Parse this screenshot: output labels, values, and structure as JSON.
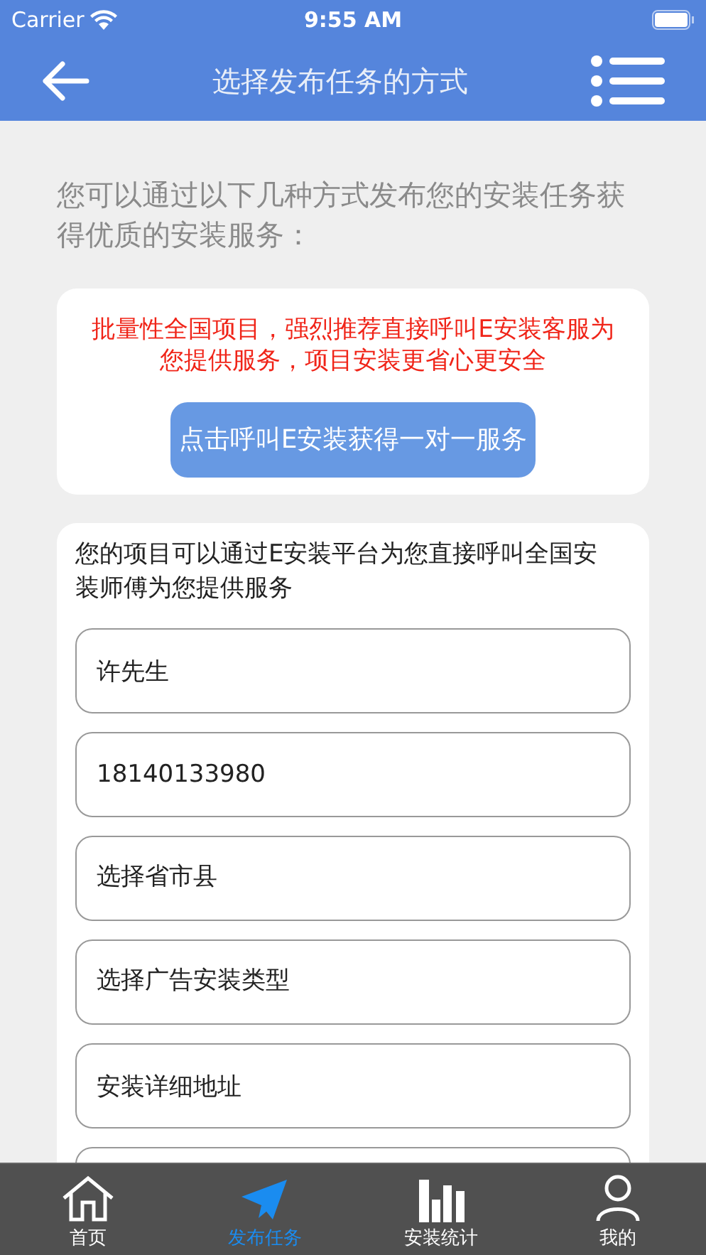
{
  "status_bar": {
    "carrier": "Carrier",
    "time": "9:55 AM"
  },
  "nav": {
    "title": "选择发布任务的方式"
  },
  "intro": "您可以通过以下几种方式发布您的安装任务获得优质的安装服务：",
  "service_card": {
    "notice": "批量性全国项目，强烈推荐直接呼叫E安装客服为您提供服务，项目安装更省心更安全",
    "button": "点击呼叫E安装获得一对一服务"
  },
  "form_card": {
    "description": "您的项目可以通过E安装平台为您直接呼叫全国安装师傅为您提供服务",
    "fields": [
      {
        "kind": "input",
        "value": "许先生"
      },
      {
        "kind": "input",
        "value": "18140133980"
      },
      {
        "kind": "select",
        "value": "选择省市县"
      },
      {
        "kind": "select",
        "value": "选择广告安装类型"
      },
      {
        "kind": "input",
        "value": "安装详细地址"
      }
    ]
  },
  "tab_bar": [
    {
      "kind": "home",
      "label": "首页",
      "selected": false
    },
    {
      "kind": "send",
      "label": "发布任务",
      "selected": true
    },
    {
      "kind": "stats",
      "label": "安装统计",
      "selected": false
    },
    {
      "kind": "user",
      "label": "我的",
      "selected": false
    }
  ]
}
